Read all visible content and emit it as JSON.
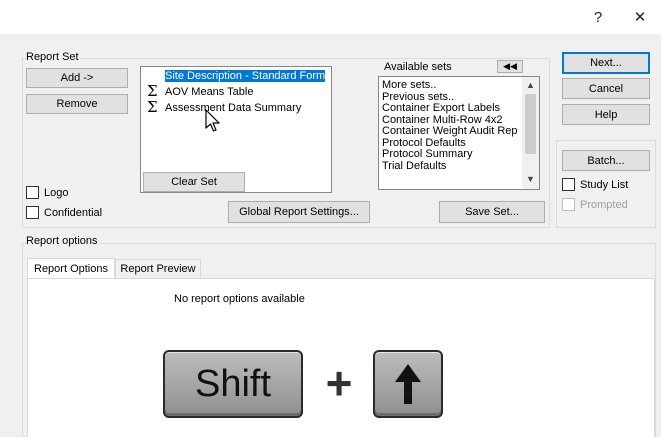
{
  "titlebar": {
    "help_label": "?",
    "close_label": "✕"
  },
  "report_set": {
    "group_label": "Report Set",
    "add_label": "Add ->",
    "remove_label": "Remove",
    "items": [
      {
        "label": "Site Description - Standard Form",
        "icon": "",
        "selected": true
      },
      {
        "label": "AOV Means Table",
        "icon": "sigma-icon",
        "selected": false
      },
      {
        "label": "Assessment Data Summary",
        "icon": "sigma-icon",
        "selected": false
      }
    ],
    "clear_set_label": "Clear Set",
    "global_settings_label": "Global Report Settings..."
  },
  "available_sets": {
    "label": "Available sets",
    "collapse_icon": "double-left-arrow-icon",
    "items": [
      "More sets..",
      "Previous sets..",
      "Container Export Labels",
      "Container Multi-Row 4x2",
      "Container Weight Audit Rep",
      "Protocol Defaults",
      "Protocol Summary",
      "Trial Defaults"
    ],
    "save_label": "Save Set..."
  },
  "options": {
    "logo_label": "Logo",
    "confidential_label": "Confidential",
    "study_list_label": "Study List",
    "prompted_label": "Prompted"
  },
  "side_buttons": {
    "next": "Next...",
    "cancel": "Cancel",
    "help": "Help",
    "batch": "Batch..."
  },
  "report_options": {
    "group_label": "Report options",
    "tabs": [
      {
        "label": "Report Options",
        "active": true
      },
      {
        "label": "Report Preview",
        "active": false
      }
    ],
    "empty_message": "No report options available"
  },
  "keystroke": {
    "key1": "Shift",
    "plus": "+",
    "key2_icon": "up-arrow-icon"
  }
}
